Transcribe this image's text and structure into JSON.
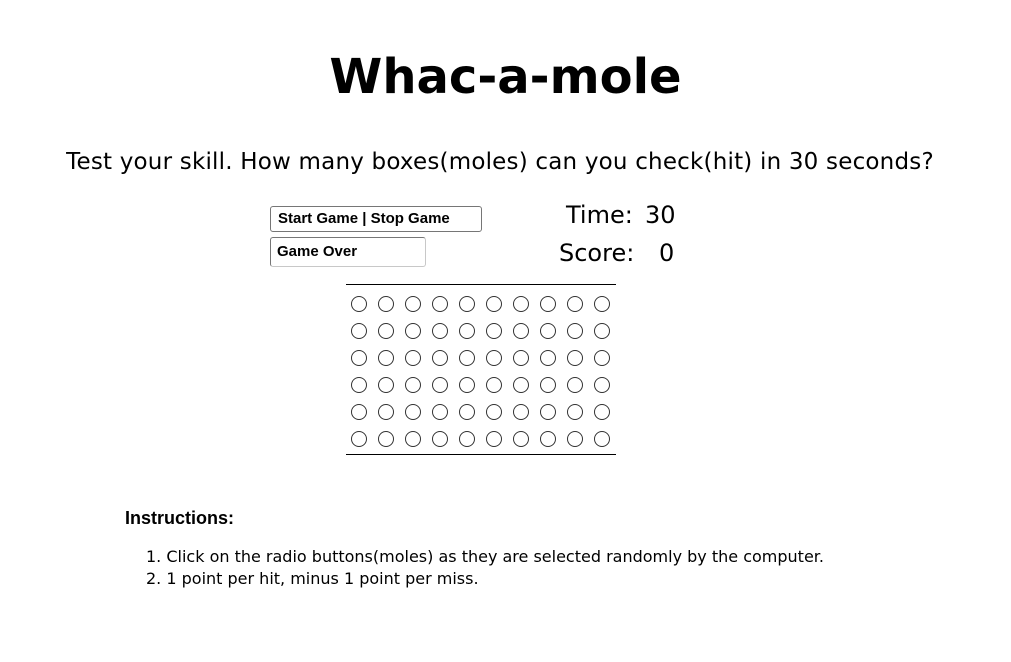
{
  "page": {
    "title": "Whac-a-mole",
    "subtitle": "Test your skill. How many boxes(moles) can you check(hit) in 30 seconds?"
  },
  "controls": {
    "start_stop_label": "Start Game | Stop Game",
    "status_value": "Game Over"
  },
  "stats": {
    "time_label": "Time:",
    "time_value": "30",
    "score_label": "Score:",
    "score_value": "0"
  },
  "board": {
    "rows": 6,
    "columns": 10,
    "selected_count": 0
  },
  "instructions": {
    "heading": "Instructions:",
    "items": [
      "1. Click on the radio buttons(moles) as they are selected randomly by the computer.",
      "2. 1 point per hit, minus 1 point per miss."
    ]
  }
}
